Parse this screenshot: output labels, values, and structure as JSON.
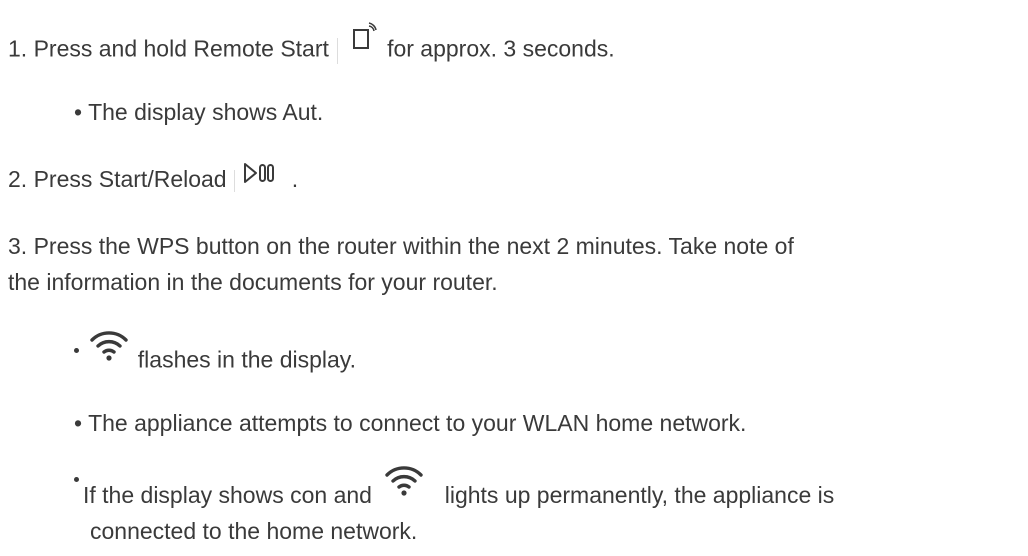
{
  "steps": {
    "s1_part1": "1. Press and hold Remote Start",
    "s1_part2": "for approx. 3 seconds.",
    "s1_bullet": "The display shows Aut.",
    "s2_part1": "2. Press Start/Reload",
    "s2_part2": ".",
    "s3_line1": "3. Press the WPS button on the router within the next 2 minutes. Take note of",
    "s3_line2": "the information in the documents for your router.",
    "b1_text": "flashes in the display.",
    "b2_text": "The appliance attempts to connect to your WLAN home network.",
    "b3_part1": "If the display shows con and",
    "b3_part2": "lights up permanently, the appliance is",
    "b3_line2": "connected to the home network."
  },
  "icons": {
    "remote_start": "remote-start-icon",
    "start_reload": "start-reload-icon",
    "wifi": "wifi-icon"
  },
  "colors": {
    "text": "#3a3a3a"
  }
}
